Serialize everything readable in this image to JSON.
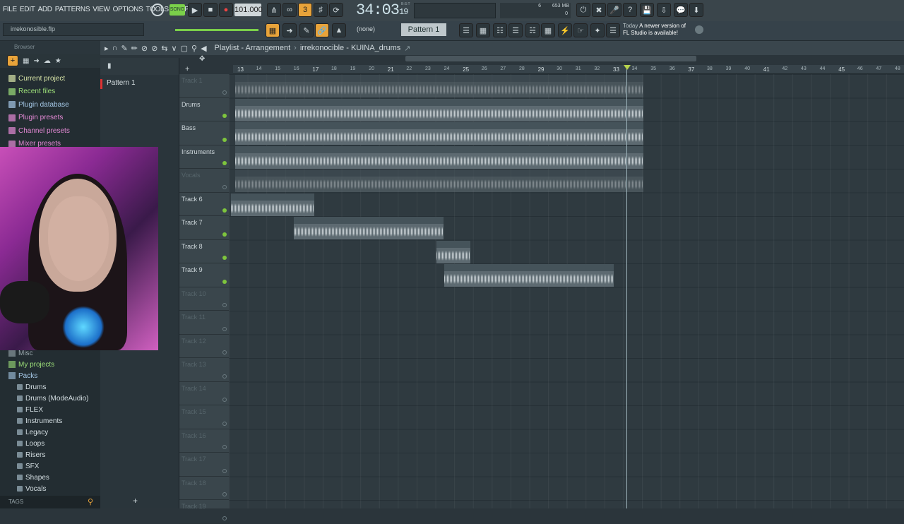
{
  "menu": [
    "FILE",
    "EDIT",
    "ADD",
    "PATTERNS",
    "VIEW",
    "OPTIONS",
    "TOOLS",
    "HELP"
  ],
  "transport": {
    "song_label": "SONG",
    "tempo": "101.000",
    "time_main": "34:03",
    "time_sub": "19",
    "time_unit": "B:S:T",
    "memory": "653 MB",
    "cpu_val": "6",
    "voices": "0"
  },
  "project": {
    "filename": "irrekonosible.flp"
  },
  "news": {
    "today": "Today",
    "line1": "A newer version of",
    "line2": "FL Studio is available!"
  },
  "pattern": {
    "selector": "Pattern 1",
    "preset": "(none)"
  },
  "browser": {
    "header": "Browser",
    "items": [
      {
        "label": "Current project",
        "color": "#d9e6a8"
      },
      {
        "label": "Recent files",
        "color": "#9ee17a"
      },
      {
        "label": "Plugin database",
        "color": "#a6c9e8"
      },
      {
        "label": "Plugin presets",
        "color": "#e58ad6"
      },
      {
        "label": "Channel presets",
        "color": "#e58ad6"
      },
      {
        "label": "Mixer presets",
        "color": "#e58ad6"
      }
    ],
    "lower": [
      {
        "label": "Misc",
        "color": "#9aa8ad"
      },
      {
        "label": "My projects",
        "color": "#9ee17a"
      },
      {
        "label": "Packs",
        "color": "#a6c9e8"
      }
    ],
    "packs": [
      "Drums",
      "Drums (ModeAudio)",
      "FLEX",
      "Instruments",
      "Legacy",
      "Loops",
      "Risers",
      "SFX",
      "Shapes",
      "Vocals"
    ],
    "tags": "TAGS"
  },
  "picker": {
    "pattern": "Pattern 1"
  },
  "playlist": {
    "title": "Playlist - Arrangement",
    "project": "irrekonocible - KUINA_drums"
  },
  "ruler": [
    "13",
    "14",
    "15",
    "16",
    "17",
    "18",
    "19",
    "20",
    "21",
    "22",
    "23",
    "24",
    "25",
    "26",
    "27",
    "28",
    "29",
    "30",
    "31",
    "32",
    "33",
    "34",
    "35",
    "36",
    "37",
    "38",
    "39",
    "40",
    "41",
    "42",
    "43",
    "44",
    "45",
    "46",
    "47",
    "48"
  ],
  "tracks": [
    {
      "name": "Track 1",
      "dim": true
    },
    {
      "name": "Drums",
      "dim": false
    },
    {
      "name": "Bass",
      "dim": false
    },
    {
      "name": "Instruments",
      "dim": false
    },
    {
      "name": "Vocals",
      "dim": true
    },
    {
      "name": "Track 6",
      "dim": false
    },
    {
      "name": "Track 7",
      "dim": false
    },
    {
      "name": "Track 8",
      "dim": false
    },
    {
      "name": "Track 9",
      "dim": false
    },
    {
      "name": "Track 10",
      "dim": true
    },
    {
      "name": "Track 11",
      "dim": true
    },
    {
      "name": "Track 12",
      "dim": true
    },
    {
      "name": "Track 13",
      "dim": true
    },
    {
      "name": "Track 14",
      "dim": true
    },
    {
      "name": "Track 15",
      "dim": true
    },
    {
      "name": "Track 16",
      "dim": true
    },
    {
      "name": "Track 17",
      "dim": true
    },
    {
      "name": "Track 18",
      "dim": true
    },
    {
      "name": "Track 19",
      "dim": true
    }
  ],
  "clips": [
    {
      "label": "irrekonocible - KUINA",
      "track": 0,
      "mute": true
    },
    {
      "label": "irrekonocible - KUINA_drums",
      "track": 1,
      "mute": false
    },
    {
      "label": "irrekonocible - KUINA_bass",
      "track": 2,
      "mute": false
    },
    {
      "label": "irrekonocible - KUINA_instruments",
      "track": 3,
      "mute": false
    },
    {
      "label": "irrekonocible - KUINA_vocals",
      "track": 4,
      "mute": true
    },
    {
      "label": "irrekonosible_20_25-58_Insert 1",
      "track": 5,
      "mute": false
    },
    {
      "label": "irrekonosible_2026-06-07 19-28-45_Insert 1",
      "track": 6,
      "mute": false
    },
    {
      "label": "irreko...ert 1",
      "track": 7,
      "mute": false
    },
    {
      "label": "irrekonosible_2026-06-07 19-42-37_Insert 1",
      "track": 8,
      "mute": false
    }
  ]
}
